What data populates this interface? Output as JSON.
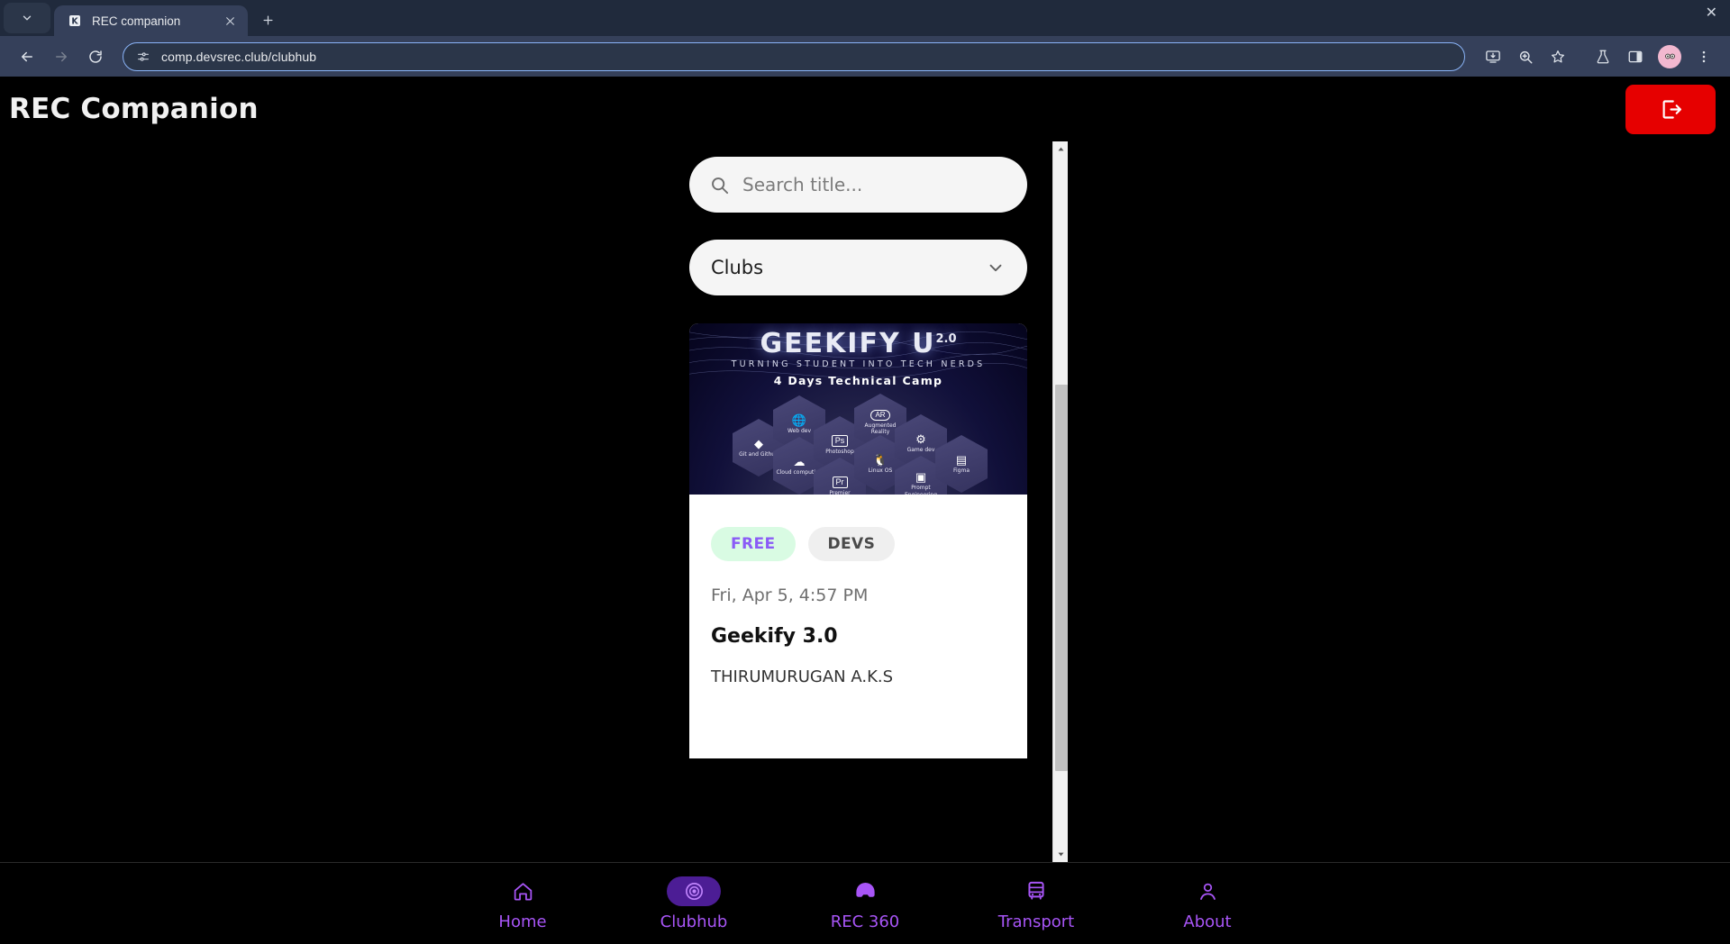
{
  "browser": {
    "tab": {
      "title": "REC companion",
      "favicon_icon": "rec-favicon",
      "close_icon": "close-icon"
    },
    "tab_search_icon": "chevron-down-icon",
    "new_tab_icon": "plus-icon",
    "window_controls": {
      "close_icon": "window-close-icon"
    },
    "nav": {
      "back_icon": "back-arrow-icon",
      "forward_icon": "forward-arrow-icon",
      "reload_icon": "reload-icon"
    },
    "omnibox": {
      "site_settings_icon": "site-settings-icon",
      "url": "comp.devsrec.club/clubhub"
    },
    "toolbar_icons": [
      "install-app-icon",
      "zoom-icon",
      "bookmark-star-icon",
      "experiments-flask-icon",
      "side-panel-icon"
    ],
    "avatar_icon": "profile-avatar-icon",
    "menu_icon": "three-dot-menu-icon"
  },
  "app": {
    "header": {
      "title": "REC Companion",
      "logout_icon": "logout-icon"
    },
    "search": {
      "placeholder": "Search title...",
      "value": "",
      "icon": "search-icon"
    },
    "filter": {
      "selected": "Clubs",
      "chevron_icon": "chevron-down-icon"
    },
    "card": {
      "poster": {
        "title": "GEEKIFY U",
        "title_sup": "2.0",
        "subtitle": "TURNING STUDENT INTO TECH NERDS",
        "camp": "4 Days Technical Camp",
        "hexes": [
          {
            "label": "Git and Github",
            "icon": "git-icon",
            "glyph": "◈"
          },
          {
            "label": "Web dev",
            "icon": "globe-icon",
            "glyph": "⊕"
          },
          {
            "label": "Cloud computing",
            "icon": "cloud-icon",
            "glyph": "☁"
          },
          {
            "label": "Photoshop",
            "icon": "photoshop-icon",
            "glyph": "Ps"
          },
          {
            "label": "Augmented Reality",
            "icon": "ar-icon",
            "glyph": "AR"
          },
          {
            "label": "Linux OS",
            "icon": "linux-tux-icon",
            "glyph": "♟"
          },
          {
            "label": "Premier",
            "icon": "premiere-icon",
            "glyph": "Pr"
          },
          {
            "label": "Game dev",
            "icon": "gamedev-icon",
            "glyph": "⚙"
          },
          {
            "label": "Prompt Engineering",
            "icon": "prompt-icon",
            "glyph": "▣"
          },
          {
            "label": "Figma",
            "icon": "figma-icon",
            "glyph": "▤"
          }
        ]
      },
      "tags": [
        {
          "label": "FREE",
          "kind": "free"
        },
        {
          "label": "DEVS",
          "kind": "devs"
        }
      ],
      "date": "Fri, Apr 5, 4:57 PM",
      "title": "Geekify 3.0",
      "author": "THIRUMURUGAN A.K.S"
    },
    "scrollbar": {
      "up_icon": "scroll-up-arrow-icon",
      "down_icon": "scroll-down-arrow-icon"
    },
    "bottom_nav": [
      {
        "label": "Home",
        "icon": "home-icon",
        "active": false
      },
      {
        "label": "Clubhub",
        "icon": "disc-icon",
        "active": true
      },
      {
        "label": "REC 360",
        "icon": "vr-headset-icon",
        "active": false
      },
      {
        "label": "Transport",
        "icon": "bus-icon",
        "active": false
      },
      {
        "label": "About",
        "icon": "person-icon",
        "active": false
      }
    ]
  },
  "colors": {
    "accent_purple": "#a855f7",
    "active_pill": "#4c1d95",
    "logout_red": "#e60000",
    "free_badge_bg": "#d9fbe3",
    "free_badge_text": "#8b5cf6"
  }
}
